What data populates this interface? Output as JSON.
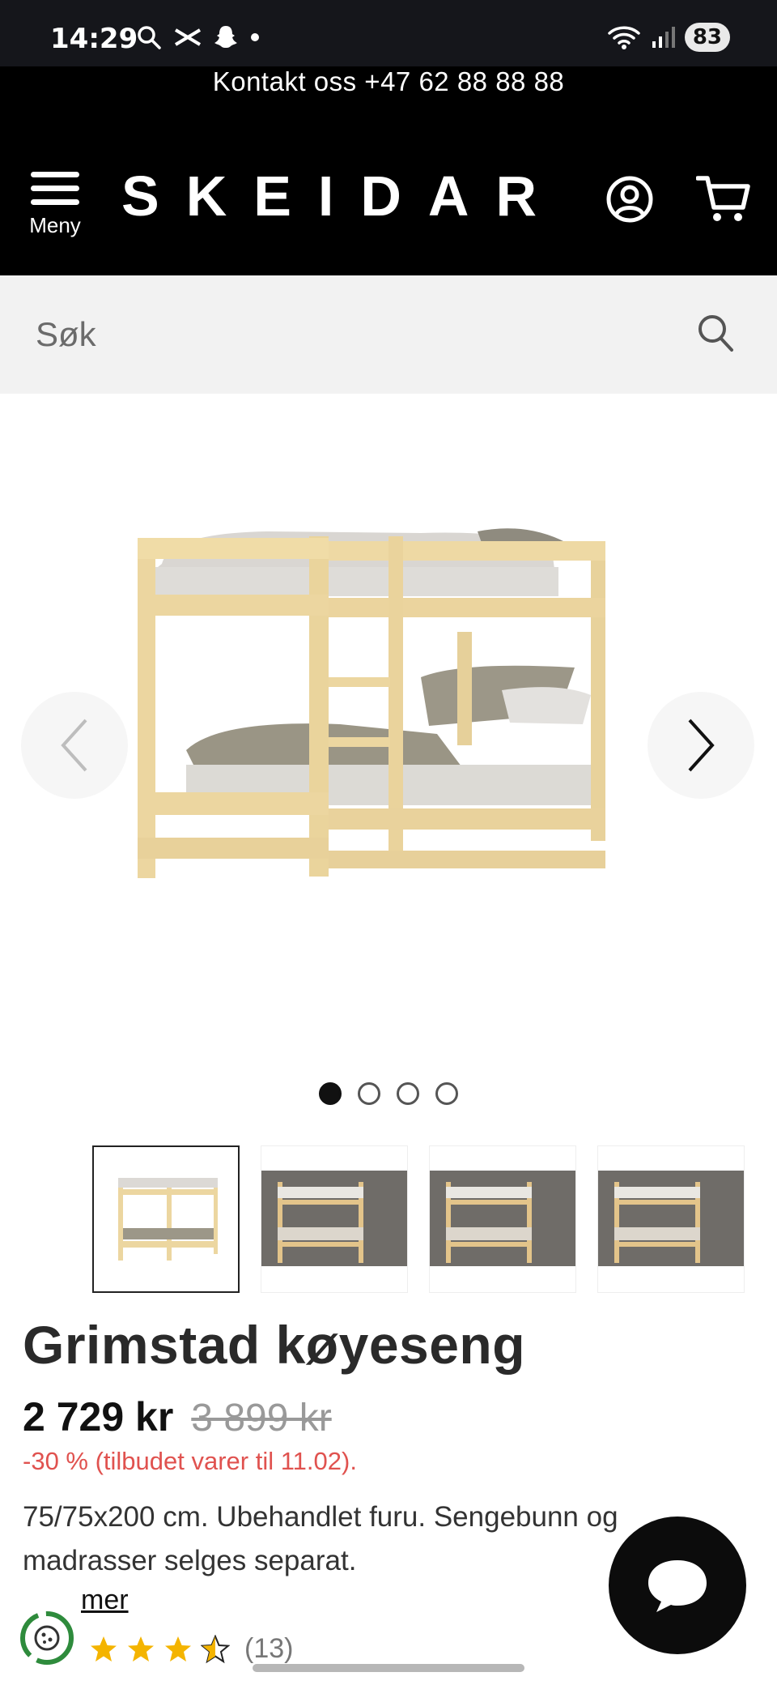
{
  "status_bar": {
    "time": "14:29",
    "battery": "83"
  },
  "header": {
    "contact": "Kontakt oss +47 62 88 88 88",
    "menu_label": "Meny",
    "logo": "SKEIDAR"
  },
  "search": {
    "placeholder": "Søk"
  },
  "gallery": {
    "slide_count": 4,
    "active_slide": 1,
    "thumbnail_count": 4
  },
  "product": {
    "title": "Grimstad køyeseng",
    "price": "2 729 kr",
    "old_price": "3 899 kr",
    "discount": "-30 % (tilbudet varer til 11.02).",
    "description": "75/75x200 cm. Ubehandlet furu. Sengebunn og madrasser selges separat.",
    "read_more": "mer",
    "rating_stars": 3.5,
    "rating_count": "(13)"
  },
  "colors": {
    "header_bg": "#000000",
    "discount_red": "#e0524f",
    "wood": "#ecd8a2"
  },
  "icons": [
    "search-icon",
    "menu-icon",
    "account-icon",
    "cart-icon",
    "chevron-left-icon",
    "chevron-right-icon",
    "chat-icon",
    "cookie-icon",
    "star-icon"
  ]
}
